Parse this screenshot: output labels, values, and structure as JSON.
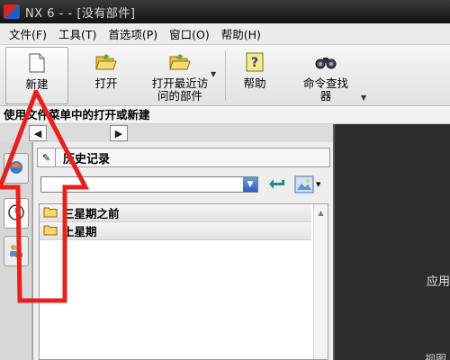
{
  "window": {
    "title": "NX 6 - - [没有部件]"
  },
  "menu": {
    "items": [
      "文件(F)",
      "工具(T)",
      "首选项(P)",
      "窗口(O)",
      "帮助(H)"
    ]
  },
  "toolbar": {
    "new_label": "新建",
    "open_label": "打开",
    "recent_label": "打开最近访问的部件",
    "help_label": "帮助",
    "find_label": "命令查找器"
  },
  "status": {
    "hint": "使用文件菜单中的打开或新建"
  },
  "history_panel": {
    "title": "历史记录",
    "search_value": "",
    "groups": [
      "三星期之前",
      "上星期"
    ]
  },
  "right_area": {
    "partial_label": "应用",
    "bottom_partial": "视图"
  },
  "colors": {
    "annotation": "#e8201e",
    "title_bar": "#1e1e1e",
    "dark_area": "#2c2c2c"
  },
  "icons": [
    "app-logo",
    "new-document-icon",
    "open-folder-icon",
    "recent-folder-icon",
    "help-icon",
    "binoculars-icon",
    "pin-icon",
    "go-arrow-icon",
    "view-icon",
    "folder-icon",
    "history-clock-icon",
    "roles-icon",
    "browser-icon"
  ]
}
